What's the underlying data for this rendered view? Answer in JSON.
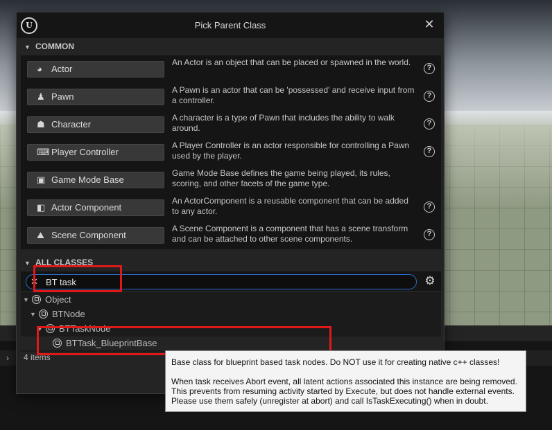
{
  "dialog": {
    "title": "Pick Parent Class",
    "close_glyph": "✕",
    "logo_text": "U"
  },
  "common": {
    "header": "COMMON",
    "items": [
      {
        "label": "Actor",
        "icon": "actor-icon",
        "description": "An Actor is an object that can be placed or spawned in the world.",
        "has_help": true
      },
      {
        "label": "Pawn",
        "icon": "pawn-icon",
        "description": "A Pawn is an actor that can be 'possessed' and receive input from a controller.",
        "has_help": true
      },
      {
        "label": "Character",
        "icon": "character-icon",
        "description": "A character is a type of Pawn that includes the ability to walk around.",
        "has_help": true
      },
      {
        "label": "Player Controller",
        "icon": "gamepad-icon",
        "description": "A Player Controller is an actor responsible for controlling a Pawn used by the player.",
        "has_help": true
      },
      {
        "label": "Game Mode Base",
        "icon": "game-mode-icon",
        "description": "Game Mode Base defines the game being played, its rules, scoring, and other facets of the game type.",
        "has_help": false
      },
      {
        "label": "Actor Component",
        "icon": "actor-component-icon",
        "description": "An ActorComponent is a reusable component that can be added to any actor.",
        "has_help": true
      },
      {
        "label": "Scene Component",
        "icon": "scene-component-icon",
        "description": "A Scene Component is a component that has a scene transform and can be attached to other scene components.",
        "has_help": true
      }
    ],
    "help_glyph": "?"
  },
  "all_classes": {
    "header": "ALL CLASSES",
    "search": {
      "value": "BT task",
      "clear_glyph": "✕"
    },
    "tree": [
      {
        "label": "Object",
        "depth": 0,
        "expanded": true,
        "has_children": true
      },
      {
        "label": "BTNode",
        "depth": 1,
        "expanded": true,
        "has_children": true
      },
      {
        "label": "BTTaskNode",
        "depth": 2,
        "expanded": true,
        "has_children": true
      },
      {
        "label": "BTTask_BlueprintBase",
        "depth": 3,
        "expanded": false,
        "has_children": false
      }
    ],
    "item_count": "4 items"
  },
  "tooltip": {
    "line1": "Base class for blueprint based task nodes. Do NOT use it for creating native c++ classes!",
    "line2": "When task receives Abort event, all latent actions associated this instance are being removed.\nThis prevents from resuming activity started by Execute, but does not handle external events.\nPlease use them safely (unregister at abort) and call IsTaskExecuting() when in doubt."
  },
  "colors": {
    "dialog_bg": "#242424",
    "search_focus": "#2b6fd0",
    "annotation": "#e01818",
    "tooltip_bg": "#f4f4f4"
  }
}
